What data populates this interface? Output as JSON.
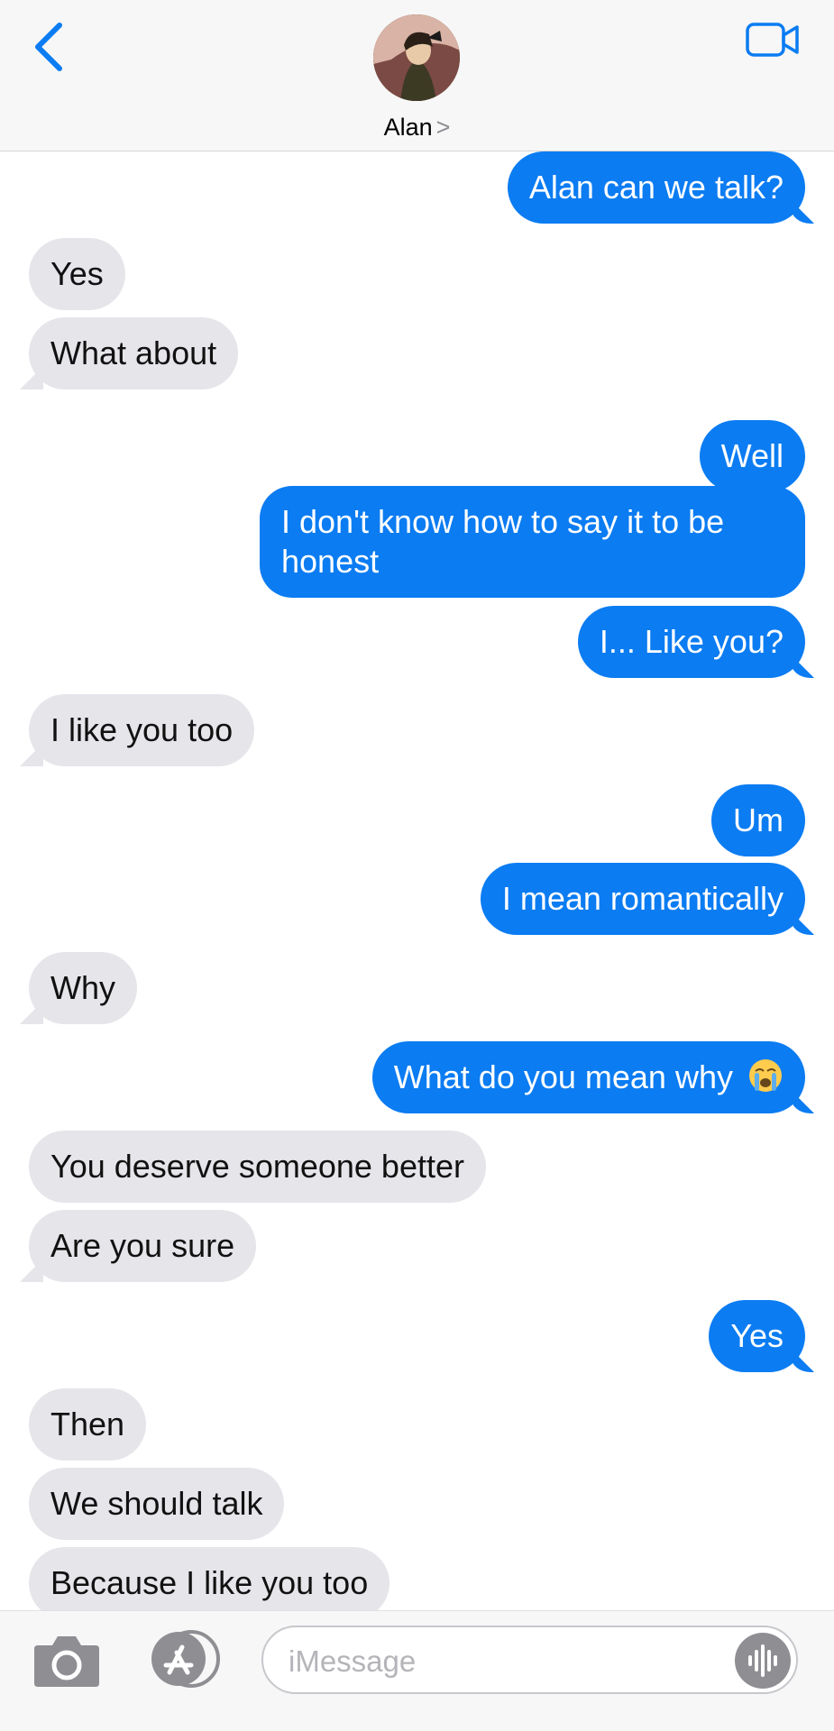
{
  "header": {
    "contact_name": "Alan",
    "name_chevron": ">",
    "icons": [
      "back-chevron-icon",
      "contact-avatar",
      "video-camera-icon"
    ]
  },
  "messages": [
    {
      "dir": "out",
      "text": "Alan can we talk?"
    },
    {
      "dir": "in",
      "text": "Yes"
    },
    {
      "dir": "in",
      "text": "What about"
    },
    {
      "dir": "out",
      "text": "Well"
    },
    {
      "dir": "out",
      "text": "I don't know how to say it to be honest"
    },
    {
      "dir": "out",
      "text": "I... Like you?"
    },
    {
      "dir": "in",
      "text": "I like you too"
    },
    {
      "dir": "out",
      "text": "Um"
    },
    {
      "dir": "out",
      "text": "I mean romantically"
    },
    {
      "dir": "in",
      "text": "Why"
    },
    {
      "dir": "out",
      "text": "What do you mean why",
      "emoji": "loudly-crying-face"
    },
    {
      "dir": "in",
      "text": "You deserve someone better"
    },
    {
      "dir": "in",
      "text": "Are you sure"
    },
    {
      "dir": "out",
      "text": "Yes"
    },
    {
      "dir": "in",
      "text": "Then"
    },
    {
      "dir": "in",
      "text": "We should talk"
    },
    {
      "dir": "in",
      "text": "Because I like you too"
    }
  ],
  "input_bar": {
    "placeholder": "iMessage",
    "icons": [
      "camera-icon",
      "app-store-icon",
      "audio-waveform-icon"
    ]
  },
  "colors": {
    "outgoing_bubble": "#0b7cf2",
    "incoming_bubble": "#e5e5ea",
    "accent": "#0b7cf2"
  }
}
